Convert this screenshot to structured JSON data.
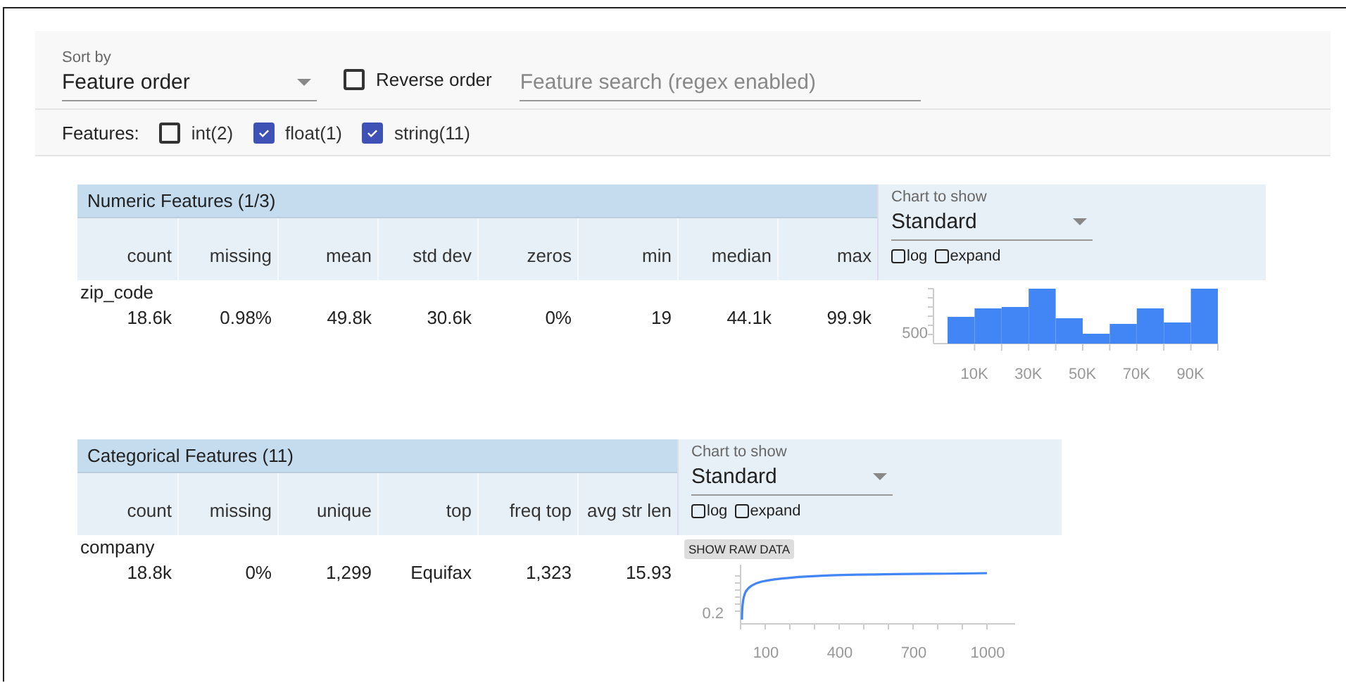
{
  "controls": {
    "sort_label": "Sort by",
    "sort_value": "Feature order",
    "reverse": {
      "label": "Reverse order",
      "checked": false
    },
    "search_placeholder": "Feature search (regex enabled)",
    "features_label": "Features:",
    "feature_types": [
      {
        "label": "int(2)",
        "checked": false
      },
      {
        "label": "float(1)",
        "checked": true
      },
      {
        "label": "string(11)",
        "checked": true
      }
    ]
  },
  "sections": [
    {
      "title": "Numeric Features (1/3)",
      "columns": [
        "count",
        "missing",
        "mean",
        "std dev",
        "zeros",
        "min",
        "median",
        "max"
      ],
      "rows": [
        {
          "name": "zip_code",
          "values": [
            "18.6k",
            "0.98%",
            "49.8k",
            "30.6k",
            "0%",
            "19",
            "44.1k",
            "99.9k"
          ]
        }
      ],
      "chart_panel": {
        "label": "Chart to show",
        "value": "Standard",
        "options": [
          {
            "label": "log",
            "checked": false
          },
          {
            "label": "expand",
            "checked": false
          }
        ]
      },
      "chart": {
        "kind": "histogram",
        "y_tick_labels": [
          "500"
        ],
        "x_tick_labels": [
          "10K",
          "30K",
          "50K",
          "70K",
          "90K"
        ]
      }
    },
    {
      "title": "Categorical Features (11)",
      "columns": [
        "count",
        "missing",
        "unique",
        "top",
        "freq top",
        "avg str len"
      ],
      "rows": [
        {
          "name": "company",
          "values": [
            "18.8k",
            "0%",
            "1,299",
            "Equifax",
            "1,323",
            "15.93"
          ]
        }
      ],
      "chart_panel": {
        "label": "Chart to show",
        "value": "Standard",
        "options": [
          {
            "label": "log",
            "checked": false
          },
          {
            "label": "expand",
            "checked": false
          }
        ]
      },
      "chart": {
        "kind": "cdf",
        "button": "SHOW RAW DATA",
        "y_tick_labels": [
          "0.2"
        ],
        "x_tick_labels": [
          "100",
          "400",
          "700",
          "1000"
        ]
      }
    }
  ]
}
